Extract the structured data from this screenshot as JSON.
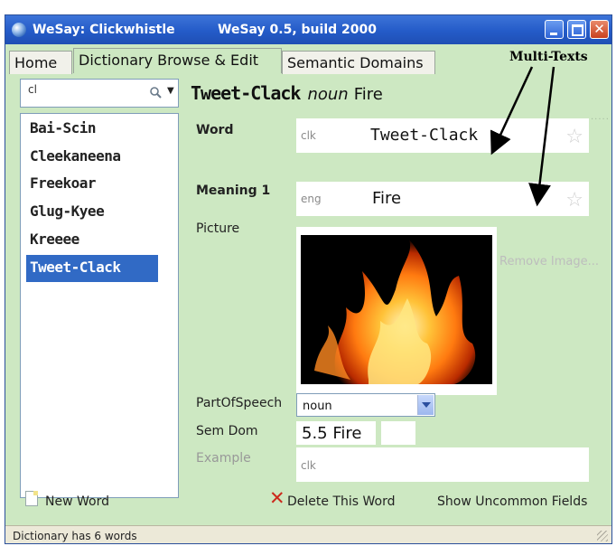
{
  "window": {
    "title_app": "WeSay: Clickwhistle",
    "title_version": "WeSay 0.5, build 2000"
  },
  "tabs": [
    {
      "label": "Home",
      "active": false
    },
    {
      "label": "Dictionary Browse & Edit",
      "active": true
    },
    {
      "label": "Semantic Domains",
      "active": false
    }
  ],
  "callout": {
    "label": "Multi-Texts"
  },
  "search": {
    "value": "cl"
  },
  "word_list": [
    {
      "word": "Bai-Scin",
      "selected": false
    },
    {
      "word": "Cleekaneena",
      "selected": false
    },
    {
      "word": "Freekoar",
      "selected": false
    },
    {
      "word": "Glug-Kyee",
      "selected": false
    },
    {
      "word": "Kreeee",
      "selected": false
    },
    {
      "word": "Tweet-Clack",
      "selected": true
    }
  ],
  "entry": {
    "headword": "Tweet-Clack",
    "part_of_speech": "noun",
    "gloss": "Fire",
    "fields": {
      "word_label": "Word",
      "word_ws": "clk",
      "word_value": "Tweet-Clack",
      "meaning_label": "Meaning 1",
      "meaning_ws": "eng",
      "meaning_value": "Fire",
      "picture_label": "Picture",
      "remove_image": "Remove Image...",
      "pos_label": "PartOfSpeech",
      "pos_value": "noun",
      "semdom_label": "Sem Dom",
      "semdom_value": "5.5 Fire",
      "example_label": "Example",
      "example_ws": "clk"
    }
  },
  "footer": {
    "new_word": "New Word",
    "delete_word": "Delete This Word",
    "show_uncommon": "Show Uncommon Fields"
  },
  "status": {
    "text": "Dictionary has 6 words"
  },
  "colors": {
    "panel_background": "#cde8c2",
    "selection": "#316ac5",
    "titlebar": "#245bc8"
  }
}
